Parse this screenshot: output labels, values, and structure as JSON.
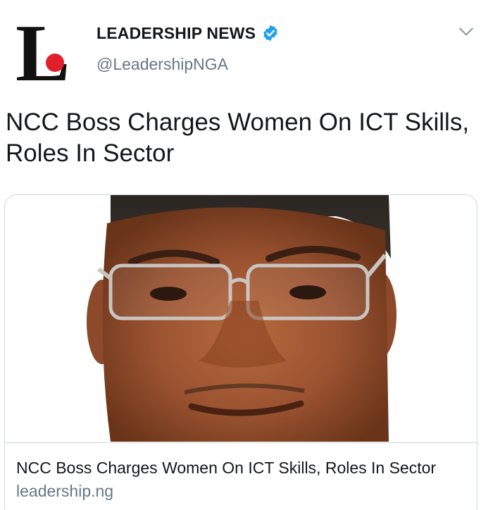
{
  "account": {
    "display_name": "LEADERSHIP NEWS",
    "handle": "@LeadershipNGA",
    "avatar_icon": "leadership-logo-icon",
    "avatar_letter": "L",
    "verified_icon": "verified-badge-icon",
    "verified_color": "#1da1f2",
    "logo_accent": "#e2202c"
  },
  "menu_icon": "chevron-down-icon",
  "tweet": {
    "text": "NCC Boss Charges Women On ICT Skills, Roles In Sector"
  },
  "card": {
    "image_icon": "portrait-photo",
    "title": "NCC Boss Charges Women On ICT Skills, Roles In Sector",
    "domain": "leadership.ng"
  }
}
